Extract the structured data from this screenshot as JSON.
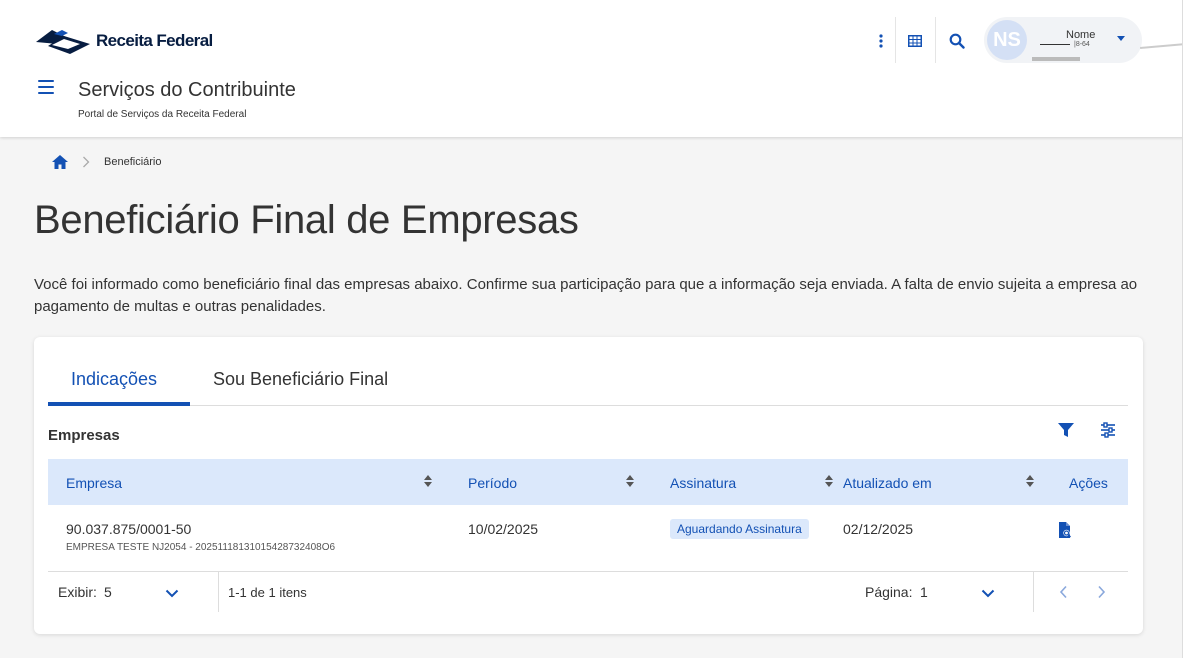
{
  "header": {
    "logo_text": "Receita Federal",
    "site_title": "Serviços do Contribuinte",
    "site_subtitle": "Portal de Serviços da Receita Federal",
    "user": {
      "initials": "NS",
      "name": "Nome",
      "id_suffix": "|8-64"
    }
  },
  "breadcrumb": {
    "items": [
      "Beneficiário"
    ]
  },
  "page": {
    "title": "Beneficiário Final de Empresas",
    "description": "Você foi informado como beneficiário final das empresas abaixo. Confirme sua participação para que a informação seja enviada. A falta de envio sujeita a empresa ao pagamento de multas e outras penalidades."
  },
  "tabs": [
    {
      "label": "Indicações",
      "active": true
    },
    {
      "label": "Sou Beneficiário Final",
      "active": false
    }
  ],
  "table": {
    "title": "Empresas",
    "columns": [
      "Empresa",
      "Período",
      "Assinatura",
      "Atualizado em",
      "Ações"
    ],
    "rows": [
      {
        "cnpj": "90.037.875/0001-50",
        "company": "EMPRESA TESTE NJ2054 - 20251118131015428732408O6",
        "periodo": "10/02/2025",
        "assinatura": "Aguardando Assinatura",
        "atualizado": "02/12/2025"
      }
    ],
    "footer": {
      "exibir_label": "Exibir:",
      "exibir_value": "5",
      "itens": "1-1 de 1 itens",
      "pagina_label": "Página:",
      "pagina_value": "1"
    }
  },
  "colors": {
    "primary": "#1351b4",
    "dark_blue": "#071d41",
    "header_row_bg": "#dbe8fb",
    "page_bg": "#f5f5f5"
  },
  "icons": [
    "menu-icon",
    "kebab-icon",
    "apps-grid-icon",
    "search-icon",
    "home-icon",
    "chevron-right-icon",
    "filter-icon",
    "column-settings-icon",
    "document-search-icon",
    "chevron-down-icon",
    "chevron-left-icon"
  ]
}
